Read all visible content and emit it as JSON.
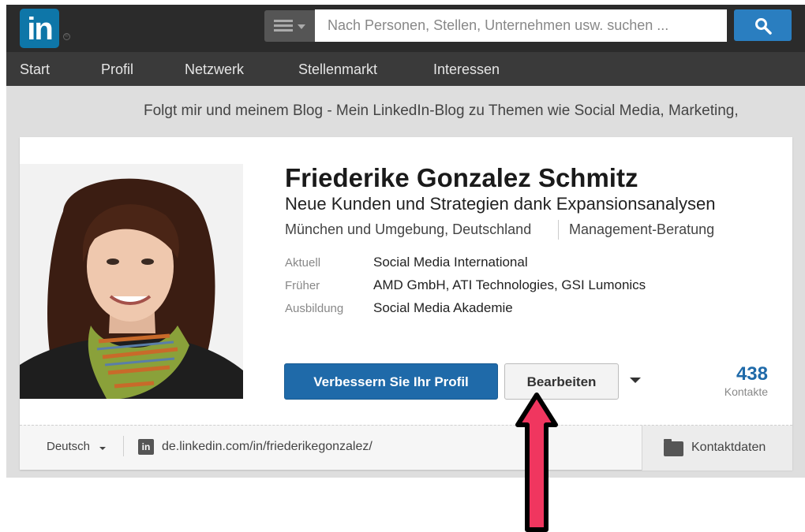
{
  "header": {
    "logo_text": "in",
    "logo_reg": "®",
    "search_placeholder": "Nach Personen, Stellen, Unternehmen usw. suchen ...",
    "search_icon": "magnifier-icon",
    "menu_icon": "hamburger-menu-icon"
  },
  "nav": {
    "items": [
      "Start",
      "Profil",
      "Netzwerk",
      "Stellenmarkt",
      "Interessen"
    ]
  },
  "tagline": "Folgt mir und meinem Blog - Mein LinkedIn-Blog zu Themen wie Social Media, Marketing,",
  "profile": {
    "name": "Friederike Gonzalez Schmitz",
    "headline": "Neue Kunden und Strategien dank Expansionsanalysen",
    "location": "München und Umgebung, Deutschland",
    "industry": "Management-Beratung",
    "details": [
      {
        "label": "Aktuell",
        "value": "Social Media International"
      },
      {
        "label": "Früher",
        "value": "AMD GmbH, ATI Technologies, GSI Lumonics"
      },
      {
        "label": "Ausbildung",
        "value": "Social Media Akademie"
      }
    ],
    "improve_button": "Verbessern Sie Ihr Profil",
    "edit_button": "Bearbeiten",
    "connections_count": "438",
    "connections_label": "Kontakte"
  },
  "footer": {
    "language": "Deutsch",
    "in_icon": "in",
    "profile_url": "de.linkedin.com/in/friederikegonzalez/",
    "contact_label": "Kontaktdaten"
  },
  "colors": {
    "brand": "#0e76a8",
    "primary_button": "#1f6aa9",
    "arrow": "#f0365f"
  }
}
